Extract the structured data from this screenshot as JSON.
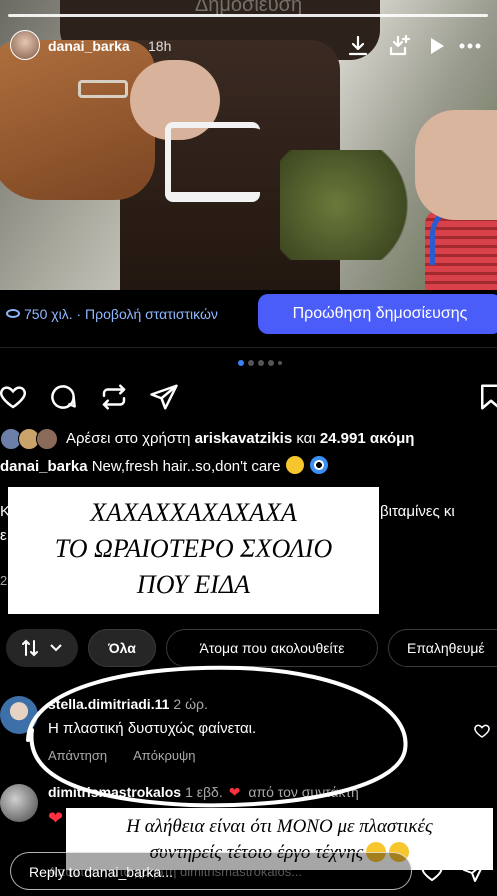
{
  "story": {
    "title": "Δημοσίευση",
    "username": "danai_barka",
    "time": "18h"
  },
  "stats": {
    "views": "750 χιλ. · Προβολή στατιστικών",
    "boost_label": "Προώθηση δημοσίευσης"
  },
  "likes": {
    "prefix": "Αρέσει στο χρήστη ",
    "user": "ariskavatzikis",
    "middle": " και ",
    "count": "24.991 ακόμη"
  },
  "caption": {
    "user": "danai_barka",
    "text": "New,fresh hair..so,don't care"
  },
  "partial_text": {
    "right_line": "βιταμίνες κι",
    "left_k": "Κ",
    "left_e": "ε",
    "left_2": "2"
  },
  "sticker_top": {
    "line1": "ΧΑΧΑΧΧΑΧΑΧΑΧΑ",
    "line2": "ΤΟ ΩΡΑΙΟΤΕΡΟ ΣΧΟΛΙΟ",
    "line3": "ΠΟΥ ΕΙΔΑ"
  },
  "filters": {
    "all": "Όλα",
    "following": "Άτομα που ακολουθείτε",
    "verified": "Επαληθευμέ"
  },
  "comments": [
    {
      "user": "stella.dimitriadi.11",
      "time": "2 ώρ.",
      "text": "Η πλαστική δυστυχώς φαίνεται.",
      "reply": "Απάντηση",
      "hide": "Απόκρυψη"
    },
    {
      "user": "dimitrismastrokalos",
      "time": "1 εβδ.",
      "liked_by": "από τον συντάκτη",
      "reply_line": "Απάντηση στο χρήστη dimitrismastrokalos..."
    }
  ],
  "sticker_bottom": {
    "line1": "Η αλήθεια είναι ότι ΜΟΝΟ με πλαστικές",
    "line2": "συντηρείς τέτοιο έργο τέχνης"
  },
  "reply_bar": {
    "placeholder": "Reply to danai_barka..."
  },
  "colors": {
    "accent": "#4a5df9",
    "stats_blue": "#8fb7ff"
  }
}
